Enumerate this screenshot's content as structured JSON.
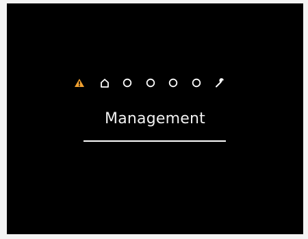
{
  "screen": {
    "title": "Management"
  },
  "nav_icons": [
    {
      "name": "warning-icon",
      "color": "#f0a030",
      "selected": false
    },
    {
      "name": "home-icon",
      "color": "#ffffff",
      "selected": false
    },
    {
      "name": "circle-icon",
      "color": "#ffffff",
      "selected": false
    },
    {
      "name": "circle-icon",
      "color": "#ffffff",
      "selected": false
    },
    {
      "name": "circle-icon",
      "color": "#ffffff",
      "selected": false
    },
    {
      "name": "circle-icon",
      "color": "#ffffff",
      "selected": false
    },
    {
      "name": "wrench-icon",
      "color": "#ffffff",
      "selected": true
    }
  ],
  "colors": {
    "background": "#000000",
    "text": "#ffffff",
    "warning": "#f0a030"
  }
}
